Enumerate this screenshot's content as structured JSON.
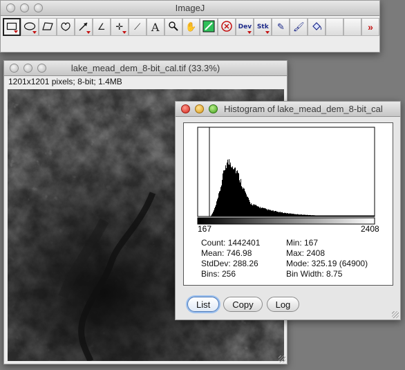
{
  "imagej": {
    "title": "ImageJ",
    "tools": [
      {
        "name": "rectangle-selection-tool",
        "icon": "rectangle-icon",
        "glyph": "",
        "selected": true,
        "submenu": true
      },
      {
        "name": "oval-selection-tool",
        "icon": "oval-icon",
        "glyph": "",
        "submenu": true
      },
      {
        "name": "polygon-selection-tool",
        "icon": "polygon-icon",
        "glyph": ""
      },
      {
        "name": "freehand-selection-tool",
        "icon": "freehand-icon",
        "glyph": ""
      },
      {
        "name": "line-selection-tool",
        "icon": "line-arrow-icon",
        "glyph": "",
        "submenu": true
      },
      {
        "name": "angle-tool",
        "icon": "angle-icon",
        "glyph": "∠"
      },
      {
        "name": "point-tool",
        "icon": "crosshair-icon",
        "glyph": "✛",
        "submenu": true
      },
      {
        "name": "wand-tool",
        "icon": "wand-icon",
        "glyph": "⟋"
      },
      {
        "name": "text-tool",
        "icon": "text-icon",
        "glyph": "A"
      },
      {
        "name": "zoom-tool",
        "icon": "magnifier-icon",
        "glyph": ""
      },
      {
        "name": "hand-tool",
        "icon": "hand-icon",
        "glyph": "✋"
      },
      {
        "name": "color-picker-tool",
        "icon": "eyedropper-icon",
        "glyph": ""
      },
      {
        "name": "remove-overlay-tool",
        "icon": "x-circle-icon",
        "glyph": ""
      },
      {
        "name": "developer-menu",
        "icon": "dev-label-icon",
        "glyph": "Dev",
        "submenu": true
      },
      {
        "name": "stack-menu",
        "icon": "stk-label-icon",
        "glyph": "Stk",
        "submenu": true
      },
      {
        "name": "pencil-tool",
        "icon": "pencil-icon",
        "glyph": "✎"
      },
      {
        "name": "brush-tool",
        "icon": "brush-icon",
        "glyph": "🖌"
      },
      {
        "name": "flood-fill-tool",
        "icon": "paint-bucket-icon",
        "glyph": ""
      },
      {
        "name": "empty-slot-1",
        "icon": "blank-icon",
        "glyph": ""
      },
      {
        "name": "empty-slot-2",
        "icon": "blank-icon",
        "glyph": ""
      },
      {
        "name": "more-tools-button",
        "icon": "double-chevron-right-icon",
        "glyph": "»"
      }
    ]
  },
  "image_window": {
    "title": "lake_mead_dem_8-bit_cal.tif (33.3%)",
    "info": "1201x1201 pixels; 8-bit; 1.4MB"
  },
  "histogram_window": {
    "title": "Histogram of lake_mead_dem_8-bit_cal",
    "axis_min": "167",
    "axis_max": "2408",
    "stats": {
      "count": "Count: 1442401",
      "mean": "Mean: 746.98",
      "stddev": "StdDev: 288.26",
      "bins": "Bins: 256",
      "min": "Min: 167",
      "max": "Max: 2408",
      "mode": "Mode: 325.19 (64900)",
      "bin_width": "Bin Width: 8.75"
    },
    "buttons": {
      "list": "List",
      "copy": "Copy",
      "log": "Log"
    }
  }
}
